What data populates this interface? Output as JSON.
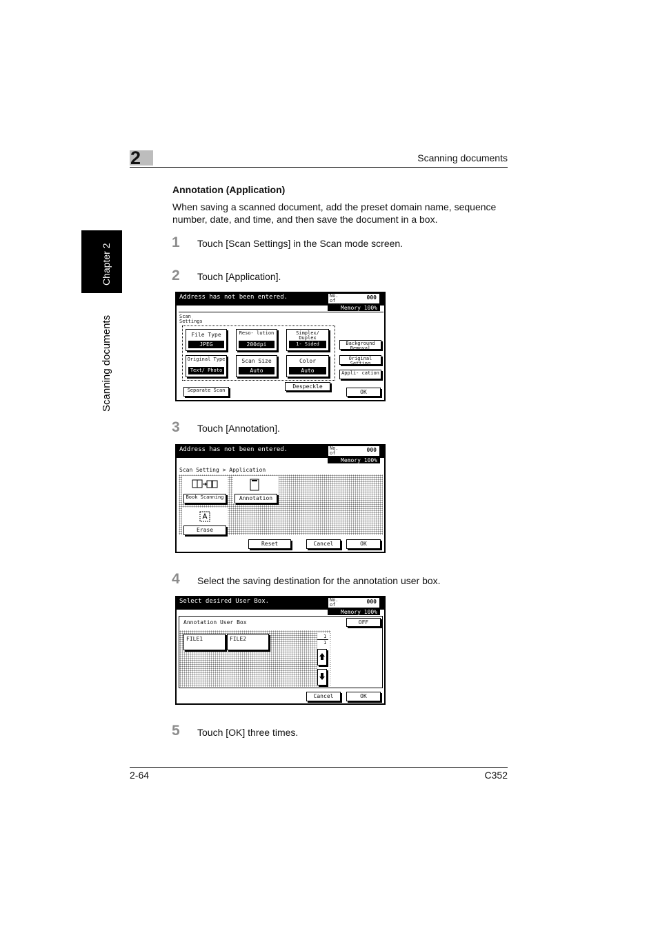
{
  "header": {
    "chapter_number": "2",
    "section_title": "Scanning documents"
  },
  "side_tab": {
    "chapter_label": "Chapter 2",
    "section_label": "Scanning documents"
  },
  "heading": "Annotation (Application)",
  "intro": "When saving a scanned document, add the preset domain name, sequence number, date, and time, and then save the document in a box.",
  "steps": [
    {
      "num": "1",
      "text": "Touch [Scan Settings] in the Scan mode screen."
    },
    {
      "num": "2",
      "text": "Touch [Application]."
    },
    {
      "num": "3",
      "text": "Touch [Annotation]."
    },
    {
      "num": "4",
      "text": "Select the saving destination for the annotation user box."
    },
    {
      "num": "5",
      "text": "Touch [OK] three times."
    }
  ],
  "screen1": {
    "message": "Address has not been entered.",
    "dest_label": "No. of Dest.",
    "dest_value": "000",
    "memory": "Memory 100%",
    "title": "Scan Settings",
    "file_type": {
      "label": "File Type",
      "value": "JPEG"
    },
    "resolution": {
      "label": "Reso- lution",
      "value": "200dpi"
    },
    "simplex": {
      "label": "Simplex/ Duplex",
      "value": "1- Sided"
    },
    "original_type": {
      "label": "Original Type",
      "value": "Text/ Photo"
    },
    "scan_size": {
      "label": "Scan Size",
      "value": "Auto"
    },
    "color": {
      "label": "Color",
      "value": "Auto"
    },
    "background_removal": "Background Removal",
    "original_setting": "Original Setting",
    "application": "Appli- cation",
    "separate_scan": "Separate Scan",
    "despeckle": "Despeckle",
    "ok": "OK"
  },
  "screen2": {
    "message": "Address has not been entered.",
    "dest_label": "No. of Dest.",
    "dest_value": "000",
    "memory": "Memory 100%",
    "breadcrumb": "Scan Setting > Application",
    "book_scanning": "Book Scanning",
    "annotation": "Annotation",
    "erase": "Erase",
    "reset": "Reset",
    "cancel": "Cancel",
    "ok": "OK"
  },
  "screen3": {
    "message": "Select desired User Box.",
    "dest_label": "No. of Dest.",
    "dest_value": "000",
    "memory": "Memory 100%",
    "box_title": "Annotation User Box",
    "off": "OFF",
    "files": [
      "FILE1",
      "FILE2"
    ],
    "page_current": "1",
    "page_total": "1",
    "cancel": "Cancel",
    "ok": "OK"
  },
  "footer": {
    "page": "2-64",
    "model": "C352"
  }
}
